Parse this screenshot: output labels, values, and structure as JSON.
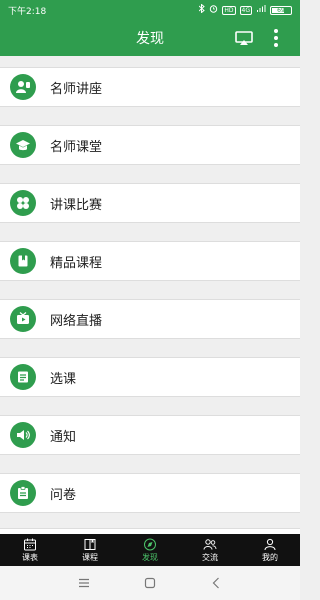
{
  "status": {
    "time": "下午2:18",
    "network": "HD",
    "signal": "4G",
    "battery": "69",
    "battery_level": 0.69
  },
  "header": {
    "title": "发现"
  },
  "menu": [
    {
      "label": "名师讲座",
      "icon": "person-lecture-icon"
    },
    {
      "label": "名师课堂",
      "icon": "graduation-cap-icon"
    },
    {
      "label": "讲课比赛",
      "icon": "clover-grid-icon"
    },
    {
      "label": "精品课程",
      "icon": "book-icon"
    },
    {
      "label": "网络直播",
      "icon": "live-tv-icon"
    },
    {
      "label": "选课",
      "icon": "document-list-icon"
    },
    {
      "label": "通知",
      "icon": "speaker-icon"
    },
    {
      "label": "问卷",
      "icon": "clipboard-icon"
    }
  ],
  "tabs": [
    {
      "label": "课表",
      "icon": "calendar-icon",
      "active": false
    },
    {
      "label": "课程",
      "icon": "book-open-icon",
      "active": false
    },
    {
      "label": "发现",
      "icon": "compass-icon",
      "active": true
    },
    {
      "label": "交流",
      "icon": "people-icon",
      "active": false
    },
    {
      "label": "我的",
      "icon": "user-icon",
      "active": false
    }
  ],
  "colors": {
    "brand": "#2f9d4e",
    "active_tab": "#4cc46a",
    "tab_bar": "#111111"
  }
}
